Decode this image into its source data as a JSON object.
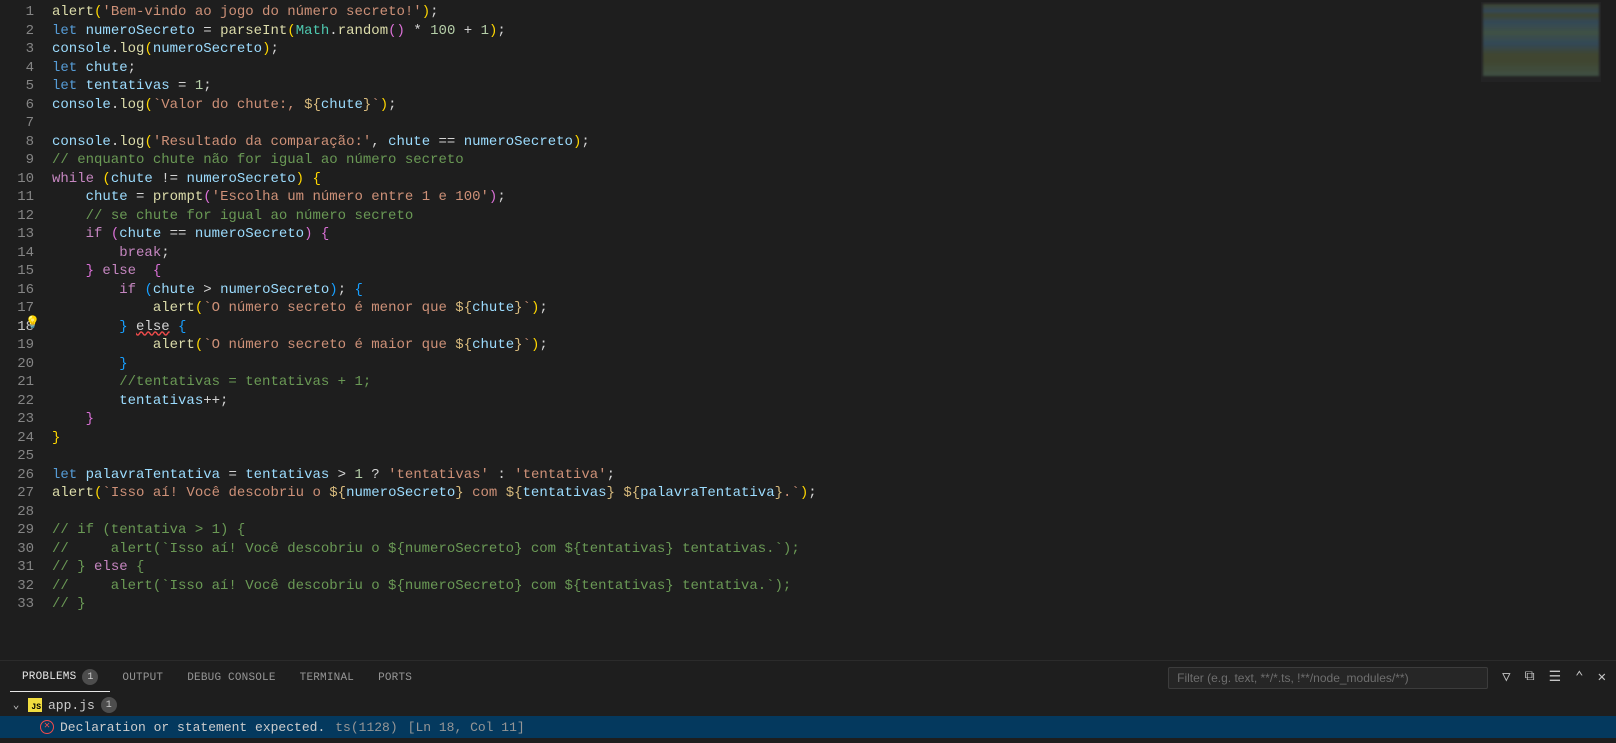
{
  "lineNumbers": [
    "1",
    "2",
    "3",
    "4",
    "5",
    "6",
    "7",
    "8",
    "9",
    "10",
    "11",
    "12",
    "13",
    "14",
    "15",
    "16",
    "17",
    "18",
    "19",
    "20",
    "21",
    "22",
    "23",
    "24",
    "25",
    "26",
    "27",
    "28",
    "29",
    "30",
    "31",
    "32",
    "33"
  ],
  "activeLineIndex": 17,
  "code": [
    [
      [
        "fn",
        "alert"
      ],
      [
        "brk0",
        "("
      ],
      [
        "str",
        "'Bem-vindo ao jogo do número secreto!'"
      ],
      [
        "brk0",
        ")"
      ],
      [
        "pun",
        ";"
      ]
    ],
    [
      [
        "kw",
        "let"
      ],
      [
        "pun",
        " "
      ],
      [
        "var",
        "numeroSecreto"
      ],
      [
        "pun",
        " = "
      ],
      [
        "fn",
        "parseInt"
      ],
      [
        "brk0",
        "("
      ],
      [
        "cls",
        "Math"
      ],
      [
        "pun",
        "."
      ],
      [
        "fn",
        "random"
      ],
      [
        "brk1",
        "("
      ],
      [
        "brk1",
        ")"
      ],
      [
        "pun",
        " * "
      ],
      [
        "num",
        "100"
      ],
      [
        "pun",
        " + "
      ],
      [
        "num",
        "1"
      ],
      [
        "brk0",
        ")"
      ],
      [
        "pun",
        ";"
      ]
    ],
    [
      [
        "var",
        "console"
      ],
      [
        "pun",
        "."
      ],
      [
        "fn",
        "log"
      ],
      [
        "brk0",
        "("
      ],
      [
        "var",
        "numeroSecreto"
      ],
      [
        "brk0",
        ")"
      ],
      [
        "pun",
        ";"
      ]
    ],
    [
      [
        "kw",
        "let"
      ],
      [
        "pun",
        " "
      ],
      [
        "var",
        "chute"
      ],
      [
        "pun",
        ";"
      ]
    ],
    [
      [
        "kw",
        "let"
      ],
      [
        "pun",
        " "
      ],
      [
        "var",
        "tentativas"
      ],
      [
        "pun",
        " = "
      ],
      [
        "num",
        "1"
      ],
      [
        "pun",
        ";"
      ]
    ],
    [
      [
        "var",
        "console"
      ],
      [
        "pun",
        "."
      ],
      [
        "fn",
        "log"
      ],
      [
        "brk0",
        "("
      ],
      [
        "str",
        "`Valor do chute:, "
      ],
      [
        "esc",
        "${"
      ],
      [
        "var",
        "chute"
      ],
      [
        "esc",
        "}"
      ],
      [
        "str",
        "`"
      ],
      [
        "brk0",
        ")"
      ],
      [
        "pun",
        ";"
      ]
    ],
    [],
    [
      [
        "var",
        "console"
      ],
      [
        "pun",
        "."
      ],
      [
        "fn",
        "log"
      ],
      [
        "brk0",
        "("
      ],
      [
        "str",
        "'Resultado da comparação:'"
      ],
      [
        "pun",
        ", "
      ],
      [
        "var",
        "chute"
      ],
      [
        "pun",
        " == "
      ],
      [
        "var",
        "numeroSecreto"
      ],
      [
        "brk0",
        ")"
      ],
      [
        "pun",
        ";"
      ]
    ],
    [
      [
        "cmt",
        "// enquanto chute não for igual ao número secreto"
      ]
    ],
    [
      [
        "kwc",
        "while"
      ],
      [
        "pun",
        " "
      ],
      [
        "brk0",
        "("
      ],
      [
        "var",
        "chute"
      ],
      [
        "pun",
        " != "
      ],
      [
        "var",
        "numeroSecreto"
      ],
      [
        "brk0",
        ")"
      ],
      [
        "pun",
        " "
      ],
      [
        "brk0",
        "{"
      ]
    ],
    [
      [
        "pun",
        "    "
      ],
      [
        "var",
        "chute"
      ],
      [
        "pun",
        " = "
      ],
      [
        "fn",
        "prompt"
      ],
      [
        "brk1",
        "("
      ],
      [
        "str",
        "'Escolha um número entre 1 e 100'"
      ],
      [
        "brk1",
        ")"
      ],
      [
        "pun",
        ";"
      ]
    ],
    [
      [
        "pun",
        "    "
      ],
      [
        "cmt",
        "// se chute for igual ao número secreto"
      ]
    ],
    [
      [
        "pun",
        "    "
      ],
      [
        "kwc",
        "if"
      ],
      [
        "pun",
        " "
      ],
      [
        "brk1",
        "("
      ],
      [
        "var",
        "chute"
      ],
      [
        "pun",
        " == "
      ],
      [
        "var",
        "numeroSecreto"
      ],
      [
        "brk1",
        ")"
      ],
      [
        "pun",
        " "
      ],
      [
        "brk1",
        "{"
      ]
    ],
    [
      [
        "pun",
        "        "
      ],
      [
        "kwc",
        "break"
      ],
      [
        "pun",
        ";"
      ]
    ],
    [
      [
        "pun",
        "    "
      ],
      [
        "brk1",
        "}"
      ],
      [
        "pun",
        " "
      ],
      [
        "kwc",
        "else"
      ],
      [
        "pun",
        "  "
      ],
      [
        "brk1",
        "{"
      ]
    ],
    [
      [
        "pun",
        "        "
      ],
      [
        "kwc",
        "if"
      ],
      [
        "pun",
        " "
      ],
      [
        "brk2",
        "("
      ],
      [
        "var",
        "chute"
      ],
      [
        "pun",
        " > "
      ],
      [
        "var",
        "numeroSecreto"
      ],
      [
        "brk2",
        ")"
      ],
      [
        "pun",
        "; "
      ],
      [
        "brk2",
        "{"
      ]
    ],
    [
      [
        "pun",
        "            "
      ],
      [
        "fn",
        "alert"
      ],
      [
        "brk0",
        "("
      ],
      [
        "str",
        "`O número secreto é menor que "
      ],
      [
        "esc",
        "${"
      ],
      [
        "var",
        "chute"
      ],
      [
        "esc",
        "}"
      ],
      [
        "str",
        "`"
      ],
      [
        "brk0",
        ")"
      ],
      [
        "pun",
        ";"
      ]
    ],
    [
      [
        "pun",
        "        "
      ],
      [
        "brk2",
        "}"
      ],
      [
        "pun",
        " "
      ],
      [
        "err",
        "else"
      ],
      [
        "pun",
        " "
      ],
      [
        "brk2",
        "{"
      ]
    ],
    [
      [
        "pun",
        "            "
      ],
      [
        "fn",
        "alert"
      ],
      [
        "brk0",
        "("
      ],
      [
        "str",
        "`O número secreto é maior que "
      ],
      [
        "esc",
        "${"
      ],
      [
        "var",
        "chute"
      ],
      [
        "esc",
        "}"
      ],
      [
        "str",
        "`"
      ],
      [
        "brk0",
        ")"
      ],
      [
        "pun",
        ";"
      ]
    ],
    [
      [
        "pun",
        "        "
      ],
      [
        "brk2",
        "}"
      ]
    ],
    [
      [
        "pun",
        "        "
      ],
      [
        "cmt",
        "//tentativas = tentativas + 1;"
      ]
    ],
    [
      [
        "pun",
        "        "
      ],
      [
        "var",
        "tentativas"
      ],
      [
        "pun",
        "++;"
      ]
    ],
    [
      [
        "pun",
        "    "
      ],
      [
        "brk1",
        "}"
      ]
    ],
    [
      [
        "brk0",
        "}"
      ]
    ],
    [],
    [
      [
        "kw",
        "let"
      ],
      [
        "pun",
        " "
      ],
      [
        "var",
        "palavraTentativa"
      ],
      [
        "pun",
        " = "
      ],
      [
        "var",
        "tentativas"
      ],
      [
        "pun",
        " > "
      ],
      [
        "num",
        "1"
      ],
      [
        "pun",
        " ? "
      ],
      [
        "str",
        "'tentativas'"
      ],
      [
        "pun",
        " : "
      ],
      [
        "str",
        "'tentativa'"
      ],
      [
        "pun",
        ";"
      ]
    ],
    [
      [
        "fn",
        "alert"
      ],
      [
        "brk0",
        "("
      ],
      [
        "str",
        "`Isso aí! Você descobriu o "
      ],
      [
        "esc",
        "${"
      ],
      [
        "var",
        "numeroSecreto"
      ],
      [
        "esc",
        "}"
      ],
      [
        "str",
        " com "
      ],
      [
        "esc",
        "${"
      ],
      [
        "var",
        "tentativas"
      ],
      [
        "esc",
        "}"
      ],
      [
        "str",
        " "
      ],
      [
        "esc",
        "${"
      ],
      [
        "var",
        "palavraTentativa"
      ],
      [
        "esc",
        "}"
      ],
      [
        "str",
        ".`"
      ],
      [
        "brk0",
        ")"
      ],
      [
        "pun",
        ";"
      ]
    ],
    [],
    [
      [
        "cmt",
        "// if (tentativa > 1) {"
      ]
    ],
    [
      [
        "cmt",
        "//     alert(`Isso aí! Você descobriu o ${numeroSecreto} com ${tentativas} tentativas.`);"
      ]
    ],
    [
      [
        "cmt",
        "// } "
      ],
      [
        "kwc",
        "else"
      ],
      [
        "cmt",
        " {"
      ]
    ],
    [
      [
        "cmt",
        "//     alert(`Isso aí! Você descobriu o ${numeroSecreto} com ${tentativas} tentativa.`);"
      ]
    ],
    [
      [
        "cmt",
        "// }"
      ]
    ]
  ],
  "panel": {
    "tabs": {
      "problems": "PROBLEMS",
      "problemsCount": "1",
      "output": "OUTPUT",
      "debugConsole": "DEBUG CONSOLE",
      "terminal": "TERMINAL",
      "ports": "PORTS"
    },
    "filterPlaceholder": "Filter (e.g. text, **/*.ts, !**/node_modules/**)",
    "problem": {
      "file": "app.js",
      "fileCount": "1",
      "message": "Declaration or statement expected.",
      "code": "ts(1128)",
      "location": "[Ln 18, Col 11]"
    }
  }
}
